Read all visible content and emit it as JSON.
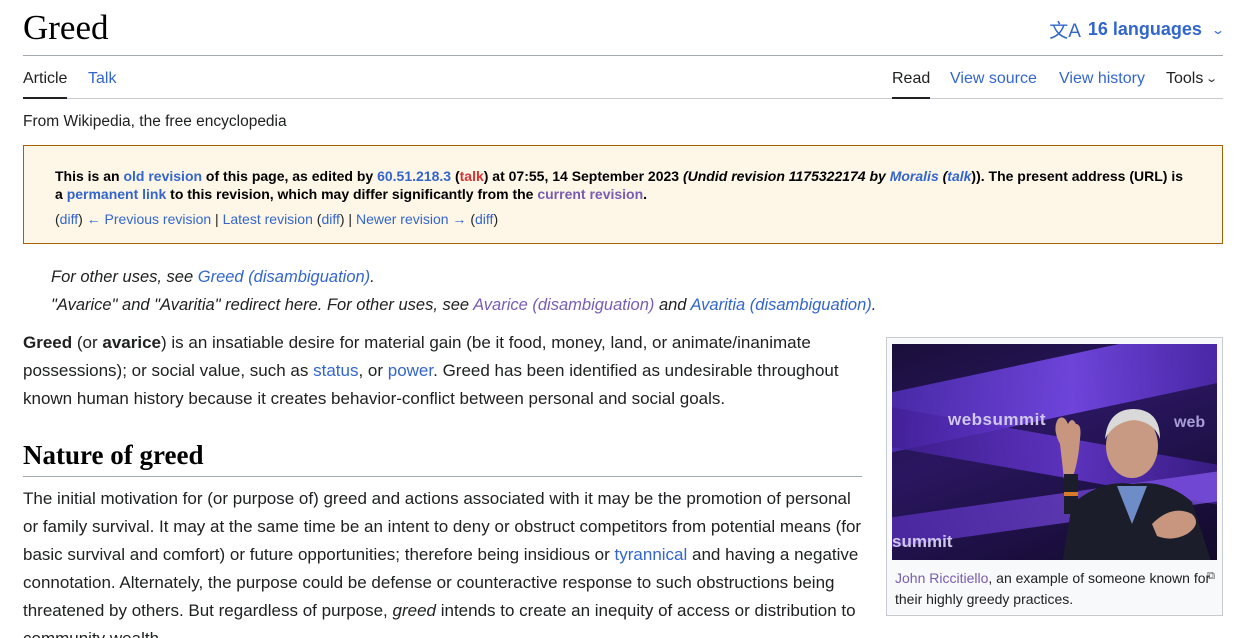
{
  "page": {
    "title": "Greed",
    "languages_label": "16 languages",
    "tagline": "From Wikipedia, the free encyclopedia"
  },
  "tabs": {
    "article": "Article",
    "talk": "Talk",
    "read": "Read",
    "view_source": "View source",
    "view_history": "View history",
    "tools": "Tools"
  },
  "revision_notice": {
    "t1": "This is an ",
    "old_revision": "old revision",
    "t2": " of this page, as edited by ",
    "editor_ip": "60.51.218.3",
    "paren_open": " (",
    "talk1": "talk",
    "t3": ") at 07:55, 14 September 2023 ",
    "undid": "(Undid revision 1175322174 by ",
    "moralis": "Moralis",
    "paren2": " (",
    "talk2": "talk",
    "t4": ")). The present address (URL) is a ",
    "permanent_link": "permanent link",
    "t5": " to this revision, which may differ significantly from the ",
    "current_revision": "current revision",
    "t6": ".",
    "nav": {
      "diff1": "diff",
      "prev": "← Previous revision",
      "latest": "Latest revision",
      "diff2": "diff",
      "newer": "Newer revision →",
      "diff3": "diff"
    }
  },
  "hatnotes": {
    "line1_text": "For other uses, see ",
    "line1_link": "Greed (disambiguation)",
    "line2_text": "\"Avarice\" and \"Avaritia\" redirect here. For other uses, see ",
    "line2_link1": "Avarice (disambiguation)",
    "line2_and": " and ",
    "line2_link2": "Avaritia (disambiguation)"
  },
  "intro": {
    "greed": "Greed",
    "t1": " (or ",
    "avarice": "avarice",
    "t2": ") is an insatiable desire for material gain (be it food, money, land, or animate/inanimate possessions); or social value, such as ",
    "status": "status",
    "t3": ", or ",
    "power": "power",
    "t4": ". Greed has been identified as undesirable throughout known human history because it creates behavior-conflict between personal and social goals."
  },
  "section": {
    "heading": "Nature of greed",
    "t1": "The initial motivation for (or purpose of) greed and actions associated with it may be the promotion of personal or family survival. It may at the same time be an intent to deny or obstruct competitors from potential means (for basic survival and comfort) or future opportunities; therefore being insidious or ",
    "tyrannical": "tyrannical",
    "t2": " and having a negative connotation. Alternately, the purpose could be defense or counteractive response to such obstructions being threatened by others. But regardless of purpose, ",
    "greed_em": "greed",
    "t3": " intends to create an inequity of access or distribution to community wealth."
  },
  "figure": {
    "logo": "websummit",
    "logo_partial": "web",
    "logo_bottom": "summit",
    "caption_link": "John Riccitiello",
    "caption_text": ", an example of someone known for their highly greedy practices."
  }
}
